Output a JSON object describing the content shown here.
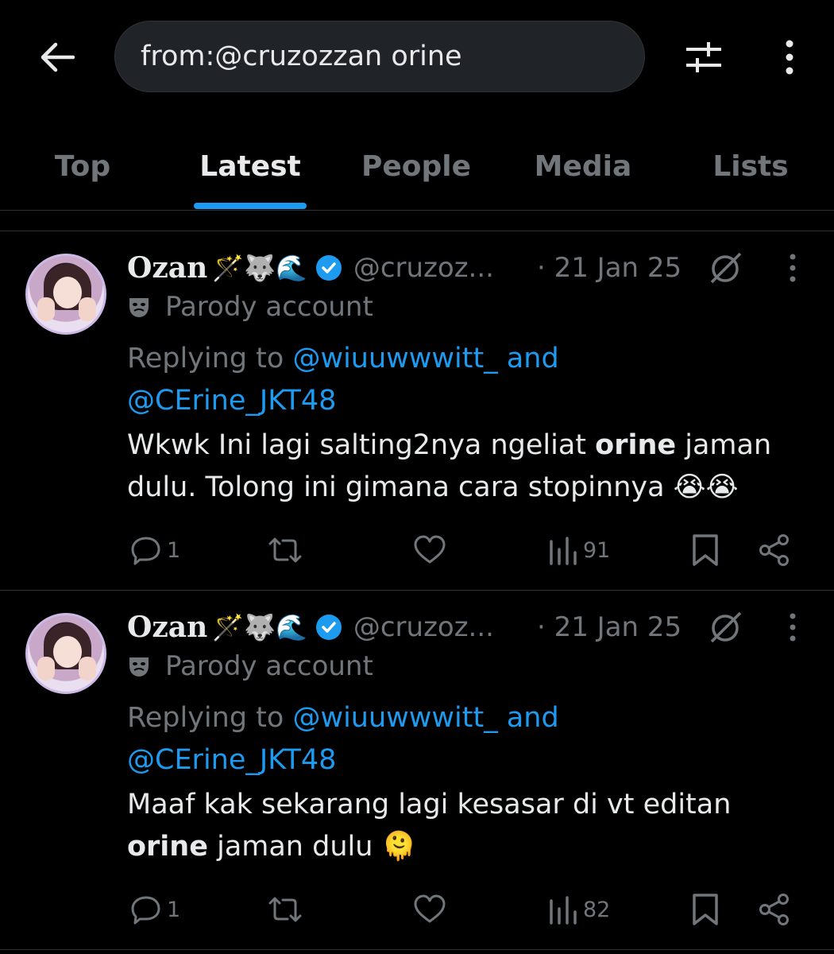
{
  "search": {
    "query": "from:@cruzozzan orine"
  },
  "tabs": [
    "Top",
    "Latest",
    "People",
    "Media",
    "Lists"
  ],
  "active_tab": "Latest",
  "tweets": [
    {
      "name": "Ozan",
      "name_emojis": "🪄🐺🌊",
      "handle": "@cruzoz...",
      "date": "· 21 Jan 25",
      "parody": "Parody account",
      "reply_prefix": "Replying to ",
      "reply_user1": "@wiuuwwwitt_",
      "reply_and": " and",
      "reply_user2": "@CErine_JKT48",
      "text_before": "Wkwk Ini lagi salting2nya ngeliat ",
      "text_bold": "orine",
      "text_after": " jaman dulu. Tolong ini gimana cara stopinnya 😭😭",
      "replies": "1",
      "views": "91"
    },
    {
      "name": "Ozan",
      "name_emojis": "🪄🐺🌊",
      "handle": "@cruzoz...",
      "date": "· 21 Jan 25",
      "parody": "Parody account",
      "reply_prefix": "Replying to ",
      "reply_user1": "@wiuuwwwitt_",
      "reply_and": " and",
      "reply_user2": "@CErine_JKT48",
      "text_before": "Maaf kak sekarang lagi kesasar di vt editan ",
      "text_bold": "orine",
      "text_after": " jaman dulu 🫠",
      "replies": "1",
      "views": "82"
    }
  ],
  "colors": {
    "accent": "#1d9bf0",
    "muted": "#71767b",
    "text": "#e7e9ea",
    "bg": "#000000"
  }
}
